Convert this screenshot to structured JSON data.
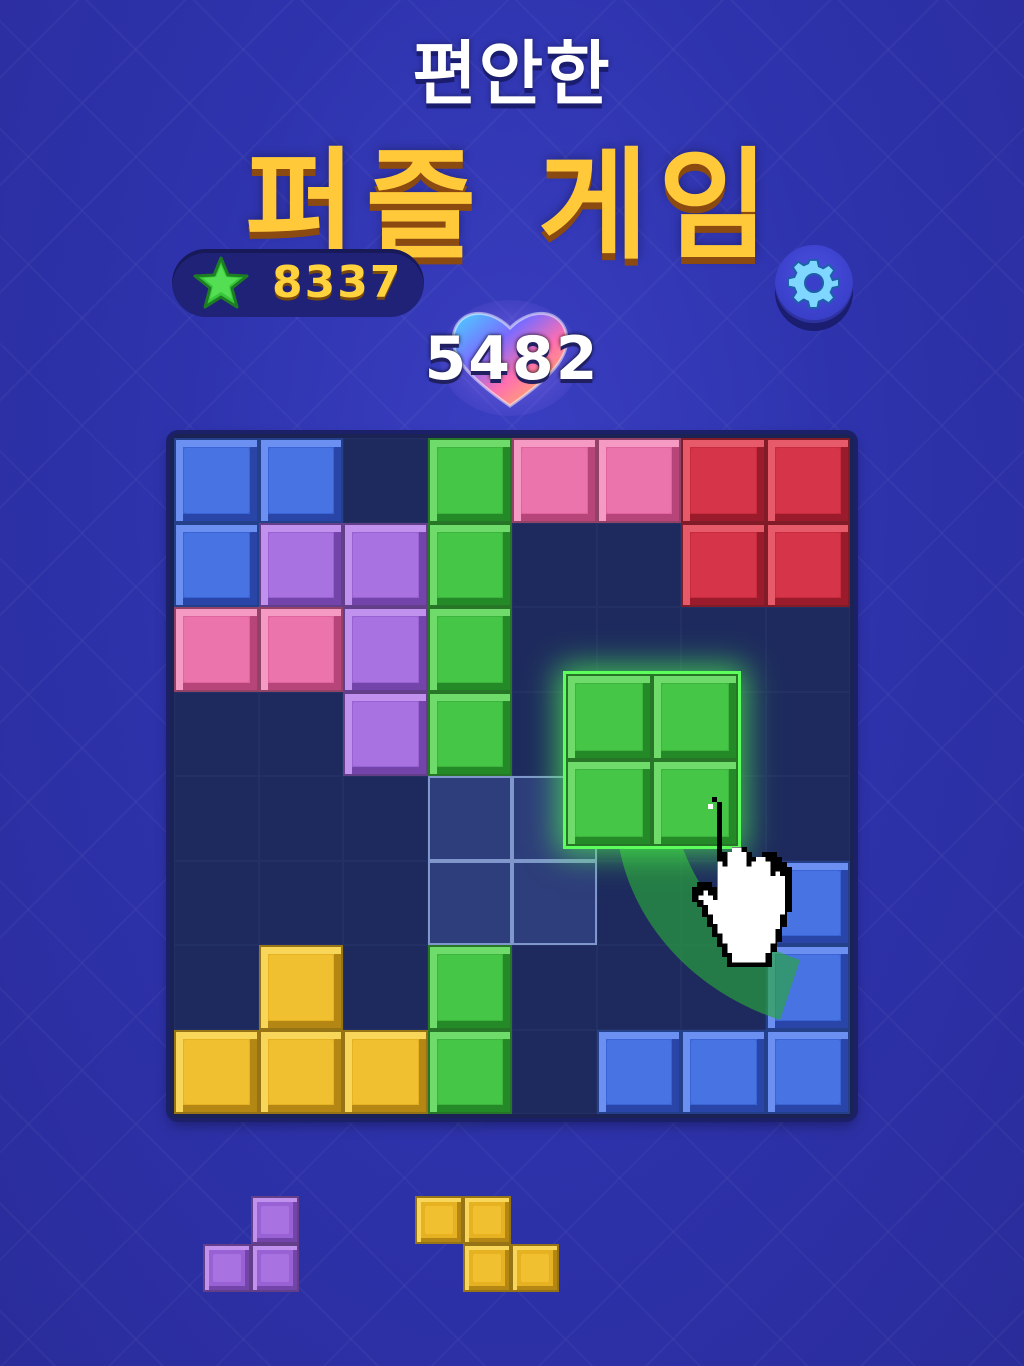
{
  "header": {
    "subtitle": "편안한",
    "title": "퍼즐 게임"
  },
  "stars": {
    "icon": "star-icon",
    "count": "8337"
  },
  "settings": {
    "icon": "gear-icon"
  },
  "score": {
    "value": "5482",
    "badge_icon": "rainbow-heart-icon"
  },
  "colors": {
    "blue": "#3a63d6",
    "purple": "#9962d4",
    "green": "#3db43d",
    "pink": "#e0649e",
    "red": "#c82a3e",
    "yellow": "#e6b221"
  },
  "board": {
    "rows": 8,
    "cols": 8,
    "cells": [
      [
        "blue",
        "blue",
        "",
        "green",
        "pink",
        "pink",
        "red",
        "red"
      ],
      [
        "blue",
        "purple",
        "purple",
        "green",
        "",
        "",
        "red",
        "red"
      ],
      [
        "pink",
        "pink",
        "purple",
        "green",
        "",
        "",
        "",
        ""
      ],
      [
        "",
        "",
        "purple",
        "green",
        "",
        "",
        "",
        ""
      ],
      [
        "",
        "",
        "",
        "",
        "",
        "",
        "",
        ""
      ],
      [
        "",
        "",
        "",
        "",
        "",
        "",
        "",
        "blue"
      ],
      [
        "",
        "yellow",
        "",
        "green",
        "",
        "",
        "",
        "blue"
      ],
      [
        "yellow",
        "yellow",
        "yellow",
        "green",
        "",
        "blue",
        "blue",
        "blue"
      ]
    ],
    "drop_hint_cells": [
      [
        4,
        3
      ],
      [
        4,
        4
      ],
      [
        5,
        3
      ],
      [
        5,
        4
      ]
    ]
  },
  "dragging_piece": {
    "color": "green",
    "shape": [
      [
        1,
        1
      ],
      [
        1,
        1
      ]
    ]
  },
  "tray": [
    {
      "color": "purple",
      "shape": [
        [
          0,
          1
        ],
        [
          1,
          1
        ]
      ]
    },
    {
      "color": "yellow",
      "shape": [
        [
          1,
          1,
          0
        ],
        [
          0,
          1,
          1
        ]
      ]
    }
  ]
}
